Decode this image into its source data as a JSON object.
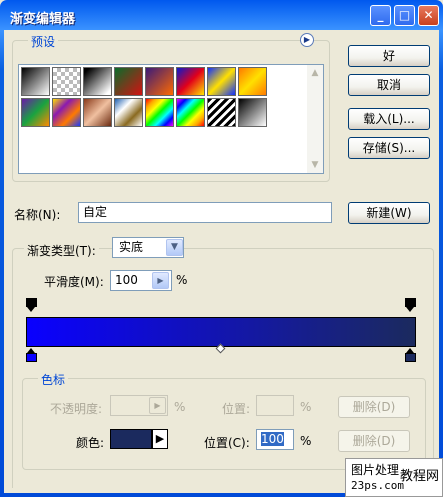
{
  "window": {
    "title": "渐变编辑器",
    "controls": {
      "minimize": "_",
      "maximize": "□",
      "close": "✕"
    }
  },
  "presets": {
    "label": "预设",
    "menu_icon": "arrow-right-circle-icon",
    "swatches": [
      {
        "name": "black-white",
        "css": "linear-gradient(135deg,#000,#fff)"
      },
      {
        "name": "transparent-checker",
        "css": "repeating-conic-gradient(#bbb 0 25%, #fff 0 50%) 0 0/8px 8px"
      },
      {
        "name": "black-transparent",
        "css": "linear-gradient(135deg,#000 10%,#fff 90%)"
      },
      {
        "name": "red-green",
        "css": "linear-gradient(135deg,#0a6b2a,#d41111)"
      },
      {
        "name": "violet-orange",
        "css": "linear-gradient(135deg,#3a1a7a,#ff6a00)"
      },
      {
        "name": "blue-red-yellow",
        "css": "linear-gradient(135deg,#0a1acd,#e2001a,#ffe600)"
      },
      {
        "name": "blue-yellow-blue",
        "css": "linear-gradient(135deg,#1030ff,#ffe000,#1030ff)"
      },
      {
        "name": "orange-yellow-orange",
        "css": "linear-gradient(135deg,#ff7a00,#ffe000,#ff7a00)"
      },
      {
        "name": "violet-green-orange",
        "css": "linear-gradient(135deg,#6a1aa8,#19a340,#ff8a00)"
      },
      {
        "name": "yellow-violet-orange-blue",
        "css": "linear-gradient(135deg,#ffe000,#8a1ab0,#ff7a00,#1a3aff)"
      },
      {
        "name": "copper",
        "css": "linear-gradient(135deg,#8a3a1a,#f0c0a0,#6a2a10)"
      },
      {
        "name": "chrome",
        "css": "linear-gradient(135deg,#2060b0,#ffffff,#8a6a20,#ffffff)"
      },
      {
        "name": "spectrum",
        "css": "linear-gradient(135deg,red,orange,yellow,lime,cyan,blue,magenta)"
      },
      {
        "name": "transparent-rainbow",
        "css": "linear-gradient(135deg,magenta,blue,cyan,lime,yellow,orange,red)"
      },
      {
        "name": "transparent-stripes",
        "css": "repeating-linear-gradient(135deg,#000 0 3px,#fff 3px 6px)"
      },
      {
        "name": "neutral-density",
        "css": "linear-gradient(135deg,#000,#fff)"
      }
    ]
  },
  "buttons": {
    "ok": "好",
    "cancel": "取消",
    "load": "载入(L)...",
    "save": "存储(S)...",
    "new": "新建(W)",
    "delete_opacity": "删除(D)",
    "delete_color": "删除(D)"
  },
  "name_row": {
    "label": "名称(N):",
    "value": "自定"
  },
  "gradient_type": {
    "label": "渐变类型(T):",
    "selected": "实底",
    "smoothness_label": "平滑度(M):",
    "smoothness_value": "100",
    "unit": "%"
  },
  "gradient": {
    "start_color": "#0a00ff",
    "end_color": "#1b2a5e",
    "left_color_stop": "#0a00ff",
    "right_color_stop": "#1b2a5e"
  },
  "stops": {
    "label": "色标",
    "opacity_label": "不透明度:",
    "opacity_value": "",
    "opacity_unit": "%",
    "opacity_location_label": "位置:",
    "opacity_location_value": "",
    "opacity_location_unit": "%",
    "color_label": "颜色:",
    "color_swatch": "#1b2a5e",
    "color_location_label": "位置(C):",
    "color_location_value": "100",
    "color_location_unit": "%"
  },
  "watermark": {
    "line1": "图片处理",
    "line1b": "教程网",
    "line2": "23ps.com"
  }
}
